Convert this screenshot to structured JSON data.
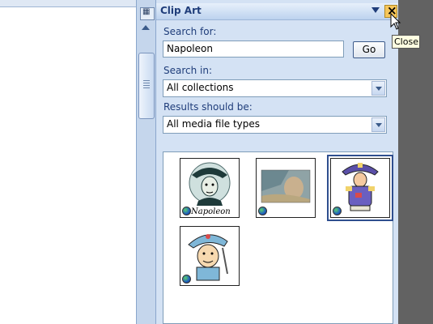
{
  "task_pane": {
    "title": "Clip Art",
    "search_for_label": "Search for:",
    "search_value": "Napoleon",
    "go_label": "Go",
    "search_in_label": "Search in:",
    "search_in_value": "All collections",
    "results_label": "Results should be:",
    "results_value": "All media file types",
    "result_items": [
      {
        "caption": "Napoleon",
        "selected": false
      },
      {
        "caption": "",
        "selected": false
      },
      {
        "caption": "",
        "selected": true
      },
      {
        "caption": "",
        "selected": false
      }
    ]
  },
  "tooltip": {
    "text": "Close"
  },
  "colors": {
    "pane_bg": "#d4e2f4",
    "title": "#1f3d7a",
    "close_highlight": "#f6c65a",
    "desktop": "#626262"
  },
  "icons": [
    "ruler-icon",
    "scroll-up-icon",
    "dropdown-arrow-icon",
    "close-icon",
    "globe-icon",
    "mouse-cursor-icon"
  ]
}
